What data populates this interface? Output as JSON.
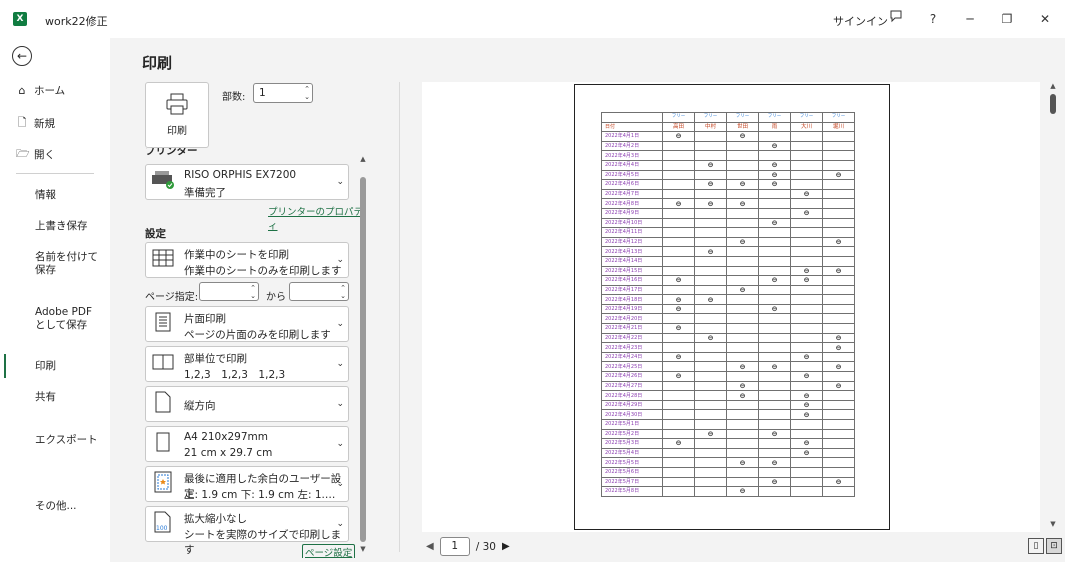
{
  "titlebar": {
    "app_icon": "excel-icon",
    "app_letter": "X",
    "title": "work22修正",
    "signin": "サインイン",
    "help": "?",
    "minimize": "─",
    "restore": "❐",
    "close": "✕"
  },
  "nav": {
    "back_icon": "back-arrow-icon",
    "home": "ホーム",
    "new": "新規",
    "open": "開く",
    "info": "情報",
    "save": "上書き保存",
    "save_as": "名前を付けて保存",
    "adobe": "Adobe PDF として保存",
    "print": "印刷",
    "share": "共有",
    "export": "エクスポート",
    "more": "その他..."
  },
  "print": {
    "title": "印刷",
    "print_button": "印刷",
    "copies_label": "部数:",
    "copies_value": "1"
  },
  "printer": {
    "section": "プリンター",
    "name": "RISO ORPHIS EX7200",
    "status": "準備完了",
    "properties_link": "プリンターのプロパティ"
  },
  "settings": {
    "section": "設定",
    "what": {
      "l1": "作業中のシートを印刷",
      "l2": "作業中のシートのみを印刷します"
    },
    "pages_label": "ページ指定:",
    "pages_from": "",
    "to_label": "から",
    "pages_to": "",
    "sides": {
      "l1": "片面印刷",
      "l2": "ページの片面のみを印刷します"
    },
    "collate": {
      "l1": "部単位で印刷",
      "l2": "1,2,3　1,2,3　1,2,3"
    },
    "orientation": {
      "l1": "縦方向"
    },
    "paper": {
      "l1": "A4 210x297mm",
      "l2": "21 cm x 29.7 cm"
    },
    "margins": {
      "l1": "最後に適用した余白のユーザー設定",
      "l2": "上: 1.9 cm 下: 1.9 cm 左: 1.…"
    },
    "scaling": {
      "l1": "拡大縮小なし",
      "l2": "シートを実際のサイズで印刷します"
    },
    "page_setup_link": "ページ設定"
  },
  "preview": {
    "current_page": "1",
    "total_pages": "/ 30",
    "header_row1": [
      "",
      "フリー",
      "フリー",
      "フリー",
      "フリー",
      "フリー",
      "フリー"
    ],
    "header_row2": [
      "日付",
      "高田",
      "中村",
      "世田",
      "雨",
      "大川",
      "堀川"
    ],
    "mark": "⊖",
    "rows": [
      {
        "date": "2022年4月1日",
        "marks": [
          1,
          0,
          1,
          0,
          0,
          0
        ]
      },
      {
        "date": "2022年4月2日",
        "marks": [
          0,
          0,
          0,
          1,
          0,
          0
        ]
      },
      {
        "date": "2022年4月3日",
        "marks": [
          0,
          0,
          0,
          0,
          0,
          0
        ]
      },
      {
        "date": "2022年4月4日",
        "marks": [
          0,
          1,
          0,
          1,
          0,
          0
        ]
      },
      {
        "date": "2022年4月5日",
        "marks": [
          0,
          0,
          0,
          1,
          0,
          1
        ]
      },
      {
        "date": "2022年4月6日",
        "marks": [
          0,
          1,
          1,
          1,
          0,
          0
        ]
      },
      {
        "date": "2022年4月7日",
        "marks": [
          0,
          0,
          0,
          0,
          1,
          0
        ]
      },
      {
        "date": "2022年4月8日",
        "marks": [
          1,
          1,
          1,
          0,
          0,
          0
        ]
      },
      {
        "date": "2022年4月9日",
        "marks": [
          0,
          0,
          0,
          0,
          1,
          0
        ]
      },
      {
        "date": "2022年4月10日",
        "marks": [
          0,
          0,
          0,
          1,
          0,
          0
        ]
      },
      {
        "date": "2022年4月11日",
        "marks": [
          0,
          0,
          0,
          0,
          0,
          0
        ]
      },
      {
        "date": "2022年4月12日",
        "marks": [
          0,
          0,
          1,
          0,
          0,
          1
        ]
      },
      {
        "date": "2022年4月13日",
        "marks": [
          0,
          1,
          0,
          0,
          0,
          0
        ]
      },
      {
        "date": "2022年4月14日",
        "marks": [
          0,
          0,
          0,
          0,
          0,
          0
        ]
      },
      {
        "date": "2022年4月15日",
        "marks": [
          0,
          0,
          0,
          0,
          1,
          1
        ]
      },
      {
        "date": "2022年4月16日",
        "marks": [
          1,
          0,
          0,
          1,
          1,
          0
        ]
      },
      {
        "date": "2022年4月17日",
        "marks": [
          0,
          0,
          1,
          0,
          0,
          0
        ]
      },
      {
        "date": "2022年4月18日",
        "marks": [
          1,
          1,
          0,
          0,
          0,
          0
        ]
      },
      {
        "date": "2022年4月19日",
        "marks": [
          1,
          0,
          0,
          1,
          0,
          0
        ]
      },
      {
        "date": "2022年4月20日",
        "marks": [
          0,
          0,
          0,
          0,
          0,
          0
        ]
      },
      {
        "date": "2022年4月21日",
        "marks": [
          1,
          0,
          0,
          0,
          0,
          0
        ]
      },
      {
        "date": "2022年4月22日",
        "marks": [
          0,
          1,
          0,
          0,
          0,
          1
        ]
      },
      {
        "date": "2022年4月23日",
        "marks": [
          0,
          0,
          0,
          0,
          0,
          1
        ]
      },
      {
        "date": "2022年4月24日",
        "marks": [
          1,
          0,
          0,
          0,
          1,
          0
        ]
      },
      {
        "date": "2022年4月25日",
        "marks": [
          0,
          0,
          1,
          1,
          0,
          1
        ]
      },
      {
        "date": "2022年4月26日",
        "marks": [
          1,
          0,
          0,
          0,
          1,
          0
        ]
      },
      {
        "date": "2022年4月27日",
        "marks": [
          0,
          0,
          1,
          0,
          0,
          1
        ]
      },
      {
        "date": "2022年4月28日",
        "marks": [
          0,
          0,
          1,
          0,
          1,
          0
        ]
      },
      {
        "date": "2022年4月29日",
        "marks": [
          0,
          0,
          0,
          0,
          1,
          0
        ]
      },
      {
        "date": "2022年4月30日",
        "marks": [
          0,
          0,
          0,
          0,
          1,
          0
        ]
      },
      {
        "date": "2022年5月1日",
        "marks": [
          0,
          0,
          0,
          0,
          0,
          0
        ]
      },
      {
        "date": "2022年5月2日",
        "marks": [
          0,
          1,
          0,
          1,
          0,
          0
        ]
      },
      {
        "date": "2022年5月3日",
        "marks": [
          1,
          0,
          0,
          0,
          1,
          0
        ]
      },
      {
        "date": "2022年5月4日",
        "marks": [
          0,
          0,
          0,
          0,
          1,
          0
        ]
      },
      {
        "date": "2022年5月5日",
        "marks": [
          0,
          0,
          1,
          1,
          0,
          0
        ]
      },
      {
        "date": "2022年5月6日",
        "marks": [
          0,
          0,
          0,
          0,
          0,
          0
        ]
      },
      {
        "date": "2022年5月7日",
        "marks": [
          0,
          0,
          0,
          1,
          0,
          1
        ]
      },
      {
        "date": "2022年5月8日",
        "marks": [
          0,
          0,
          1,
          0,
          0,
          0
        ]
      }
    ]
  }
}
